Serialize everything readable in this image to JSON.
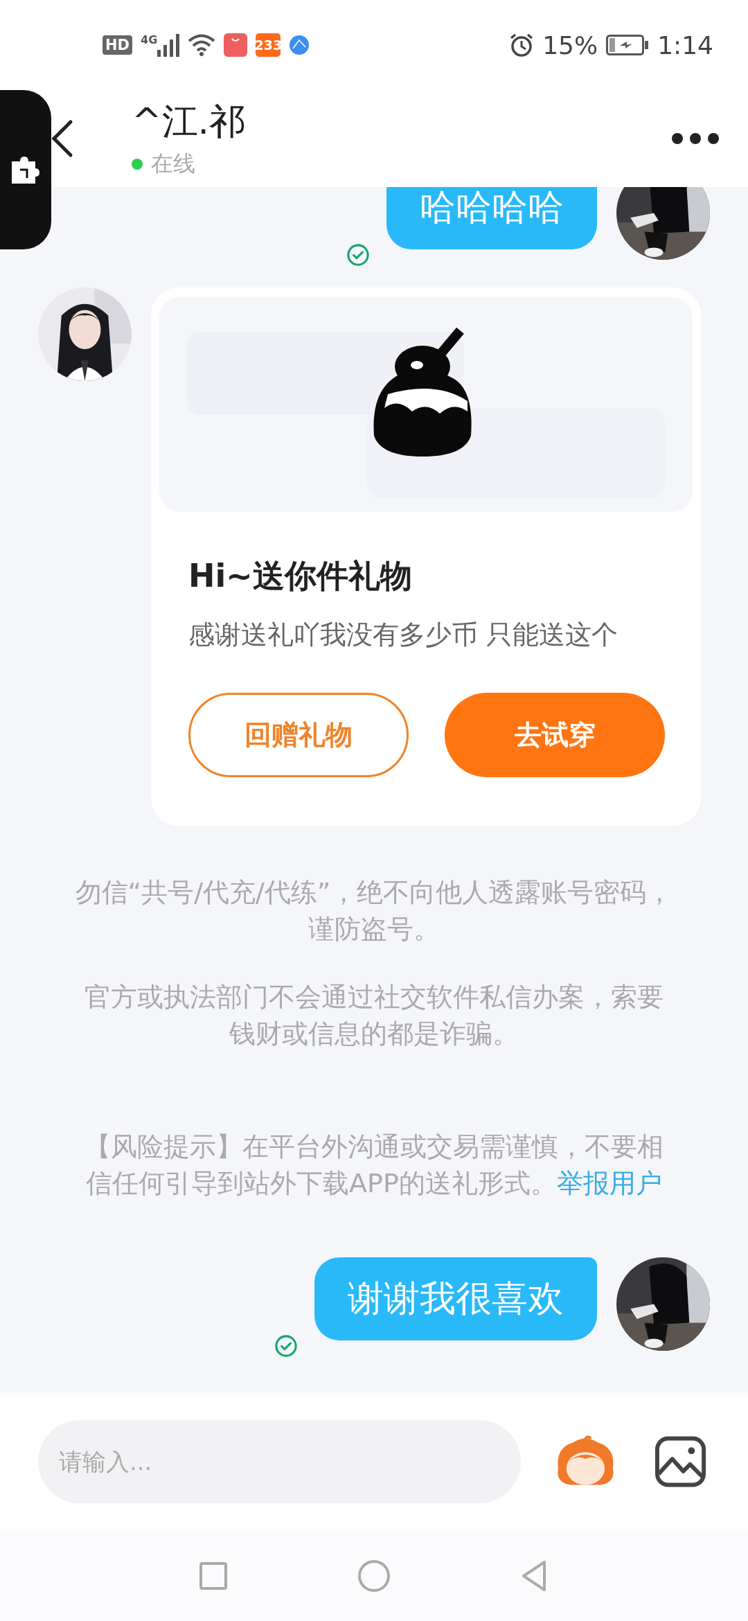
{
  "status_bar": {
    "hd_badge": "HD",
    "network": "4G",
    "app_badge": "233",
    "battery": "15%",
    "time": "1:14"
  },
  "header": {
    "title": "^江.祁",
    "status": "在线",
    "online": true
  },
  "messages": [
    {
      "kind": "text",
      "outgoing": true,
      "text": "哈哈哈哈",
      "read": true
    },
    {
      "kind": "gift",
      "outgoing": false,
      "title": "Hi~送你件礼物",
      "description": "感谢送礼吖我没有多少币 只能送这个",
      "buttons": [
        {
          "label": "回赠礼物",
          "kind": "outline"
        },
        {
          "label": "去试穿",
          "kind": "filled"
        }
      ]
    },
    {
      "kind": "notice",
      "text": "勿信“共号/代充/代练”，绝不向他人透露账号密码，谨防盗号。"
    },
    {
      "kind": "notice",
      "text": "官方或执法部门不会通过社交软件私信办案，索要钱财或信息的都是诈骗。"
    },
    {
      "kind": "risk",
      "text": "【风险提示】在平台外沟通或交易需谨慎，不要相信任何引导到站外下载APP的送礼形式。",
      "link": "举报用户"
    },
    {
      "kind": "text",
      "outgoing": true,
      "text": "谢谢我很喜欢",
      "read": true
    }
  ],
  "input": {
    "placeholder": "请输入..."
  }
}
